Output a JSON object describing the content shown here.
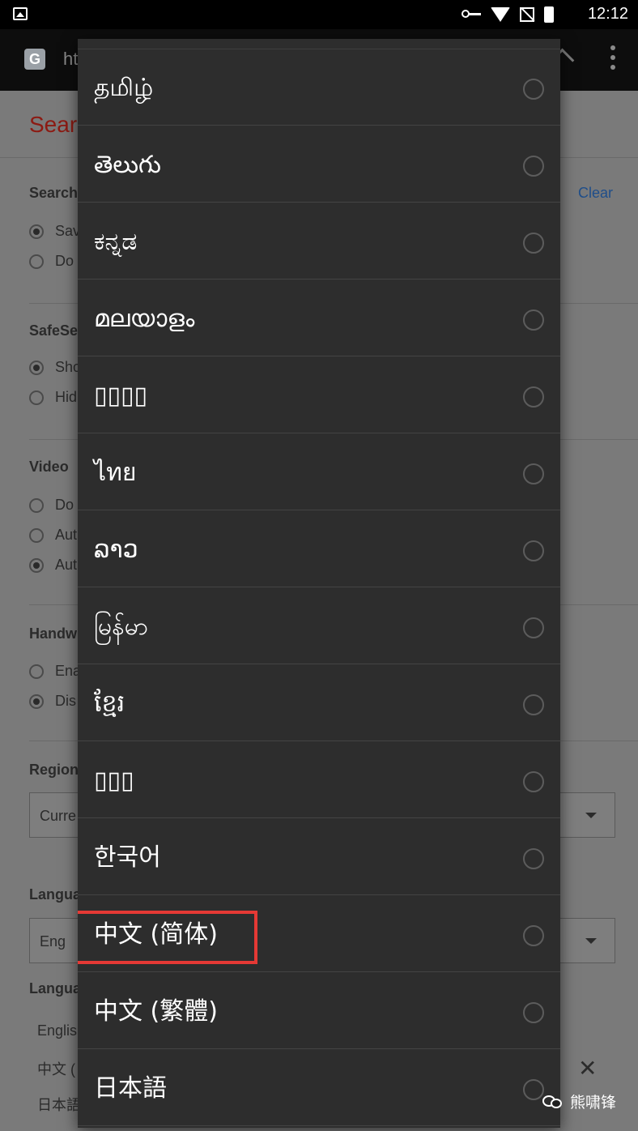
{
  "status_bar": {
    "time": "12:12",
    "icons": [
      "image-icon",
      "vpn-key-icon",
      "wifi-icon",
      "no-signal-icon",
      "battery-charging-icon"
    ]
  },
  "browser": {
    "url_partial": "ht"
  },
  "background_page": {
    "title_partial": "Sear",
    "clear_link": "Clear",
    "sections": {
      "search_partial": "Search",
      "search_opt1": "Sav",
      "search_opt2": "Do",
      "safe_partial": "SafeSe",
      "safe_opt1": "Sho",
      "safe_opt2": "Hid",
      "video": "Video",
      "video_opt1": "Do",
      "video_opt2": "Aut",
      "video_opt3": "Aut",
      "hand_partial": "Handw",
      "hand_opt1": "Ena",
      "hand_opt2": "Dis",
      "region_partial": "Region",
      "region_select_partial": "Curre",
      "lang1_partial": "Langua",
      "lang_select_partial": "Eng",
      "lang2_partial": "Langua",
      "list1": "Englis",
      "list2": "中文 (",
      "list3": "日本語"
    }
  },
  "dialog": {
    "options": [
      {
        "label": "தமிழ்"
      },
      {
        "label": "తెలుగు"
      },
      {
        "label": "ಕನ್ನಡ"
      },
      {
        "label": "മലയാളം"
      },
      {
        "label": "▯▯▯▯"
      },
      {
        "label": "ไทย"
      },
      {
        "label": "ລາວ"
      },
      {
        "label": "မြန်မာ"
      },
      {
        "label": "ខ្មែរ"
      },
      {
        "label": "▯▯▯"
      },
      {
        "label": "한국어"
      },
      {
        "label": "中文 (简体)"
      },
      {
        "label": "中文 (繁體)"
      },
      {
        "label": "日本語"
      }
    ],
    "highlighted_option": "中文 (简体)",
    "highlight_color": "#e53935"
  },
  "watermark": {
    "text": "熊啸锋"
  }
}
